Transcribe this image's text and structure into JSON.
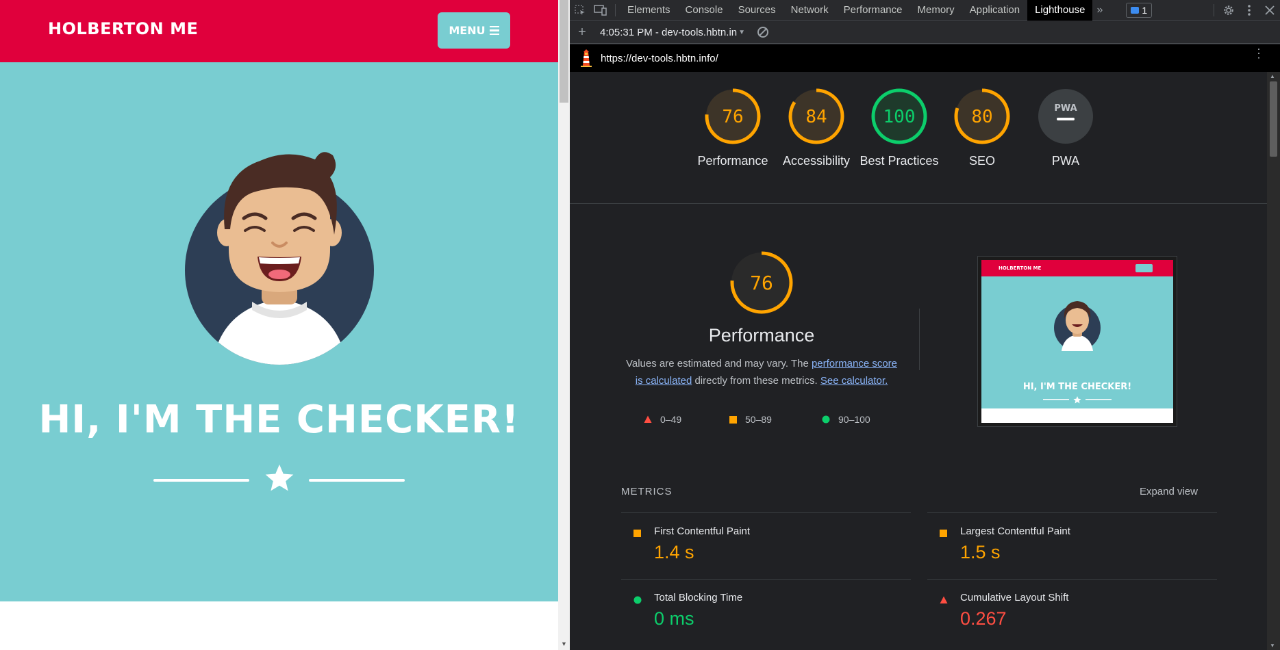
{
  "site": {
    "brand": "HOLBERTON ME",
    "menu_label": "MENU",
    "hero_title": "HI, I'M THE CHECKER!",
    "colors": {
      "header": "#e0003c",
      "hero": "#79cdd1"
    }
  },
  "devtools": {
    "tabs": [
      "Elements",
      "Console",
      "Sources",
      "Network",
      "Performance",
      "Memory",
      "Application",
      "Lighthouse"
    ],
    "active_tab": "Lighthouse",
    "issues_count": "1",
    "report_selector": "4:05:31 PM - dev-tools.hbtn.in",
    "url": "https://dev-tools.hbtn.info/"
  },
  "gauges": [
    {
      "score": "76",
      "label": "Performance",
      "color": "#ffa400",
      "fraction": 0.76
    },
    {
      "score": "84",
      "label": "Accessibility",
      "color": "#ffa400",
      "fraction": 0.84
    },
    {
      "score": "100",
      "label": "Best Practices",
      "color": "#0cce6b",
      "fraction": 1.0
    },
    {
      "score": "80",
      "label": "SEO",
      "color": "#ffa400",
      "fraction": 0.8
    },
    {
      "score": "PWA",
      "label": "PWA",
      "color": "#9aa0a6",
      "fraction": 0
    }
  ],
  "performance": {
    "score": "76",
    "title": "Performance",
    "desc_before": "Values are estimated and may vary. The ",
    "desc_link1": "performance score is calculated",
    "desc_middle": " directly from these metrics. ",
    "desc_link2": "See calculator.",
    "legend": [
      "0–49",
      "50–89",
      "90–100"
    ],
    "thumb_brand": "HOLBERTON ME",
    "thumb_title": "HI, I'M THE CHECKER!"
  },
  "metrics": {
    "title": "METRICS",
    "expand_label": "Expand view",
    "items": [
      {
        "name": "First Contentful Paint",
        "value": "1.4 s",
        "status": "average"
      },
      {
        "name": "Largest Contentful Paint",
        "value": "1.5 s",
        "status": "average"
      },
      {
        "name": "Total Blocking Time",
        "value": "0 ms",
        "status": "pass"
      },
      {
        "name": "Cumulative Layout Shift",
        "value": "0.267",
        "status": "fail"
      }
    ],
    "status_colors": {
      "pass": "#0cce6b",
      "average": "#ffa400",
      "fail": "#ff4e42"
    }
  }
}
